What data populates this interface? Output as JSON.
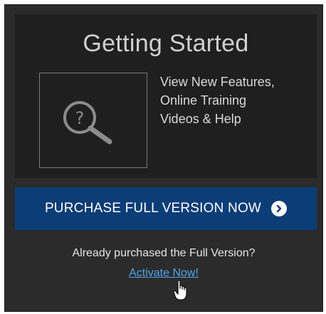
{
  "getting_started": {
    "title": "Getting Started",
    "help_icon": "magnifier-question-icon",
    "description_lines": [
      "View New Features,",
      "Online Training",
      "Videos & Help"
    ]
  },
  "purchase": {
    "label": "PURCHASE FULL VERSION NOW",
    "icon": "chevron-right-circle-icon",
    "color": "#0b3d77"
  },
  "activation": {
    "prompt": "Already purchased the Full Version?",
    "link_label": "Activate Now!",
    "link_color": "#4fa6ee"
  },
  "cursor": {
    "icon": "hand-pointer-icon"
  }
}
